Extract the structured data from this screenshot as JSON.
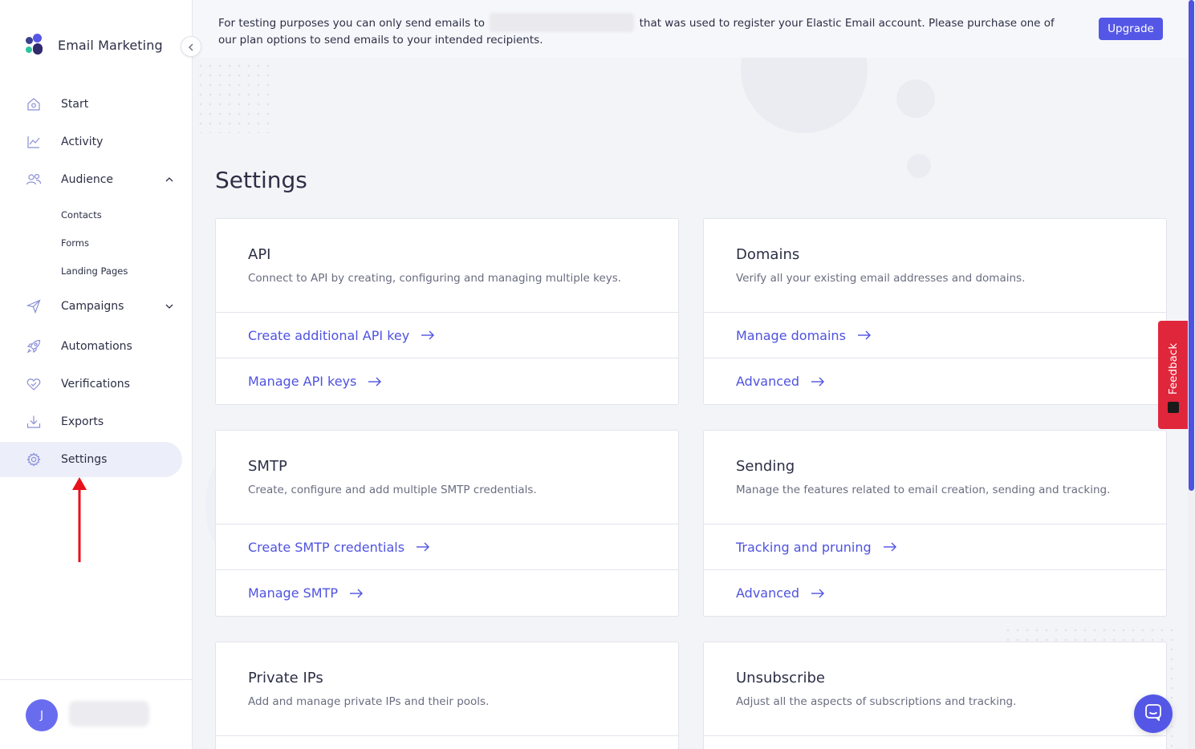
{
  "app": {
    "brand_name": "Email Marketing"
  },
  "sidebar": {
    "items": [
      {
        "key": "start",
        "label": "Start",
        "icon": "home-icon"
      },
      {
        "key": "activity",
        "label": "Activity",
        "icon": "chart-line-icon"
      },
      {
        "key": "audience",
        "label": "Audience",
        "icon": "users-icon",
        "expanded": true,
        "children": [
          {
            "label": "Contacts"
          },
          {
            "label": "Forms"
          },
          {
            "label": "Landing Pages"
          }
        ]
      },
      {
        "key": "campaigns",
        "label": "Campaigns",
        "icon": "paper-plane-icon",
        "expanded": false
      },
      {
        "key": "automations",
        "label": "Automations",
        "icon": "rocket-icon"
      },
      {
        "key": "verifications",
        "label": "Verifications",
        "icon": "heart-check-icon"
      },
      {
        "key": "exports",
        "label": "Exports",
        "icon": "download-icon"
      },
      {
        "key": "settings",
        "label": "Settings",
        "icon": "gear-icon",
        "active": true
      }
    ],
    "user": {
      "avatar_initial": "J"
    }
  },
  "banner": {
    "text_before": "For testing purposes you can only send emails to ",
    "text_after": " that was used to register your Elastic Email account. Please purchase one of our plan options to send emails to your intended recipients.",
    "upgrade_label": "Upgrade"
  },
  "main": {
    "title": "Settings",
    "cards": [
      {
        "title": "API",
        "description": "Connect to API by creating, configuring and managing multiple keys.",
        "links": [
          "Create additional API key",
          "Manage API keys"
        ]
      },
      {
        "title": "Domains",
        "description": "Verify all your existing email addresses and domains.",
        "links": [
          "Manage domains",
          "Advanced"
        ]
      },
      {
        "title": "SMTP",
        "description": "Create, configure and add multiple SMTP credentials.",
        "links": [
          "Create SMTP credentials",
          "Manage SMTP"
        ]
      },
      {
        "title": "Sending",
        "description": "Manage the features related to email creation, sending and tracking.",
        "links": [
          "Tracking and pruning",
          "Advanced"
        ]
      },
      {
        "title": "Private IPs",
        "description": "Add and manage private IPs and their pools.",
        "links": []
      },
      {
        "title": "Unsubscribe",
        "description": "Adjust all the aspects of subscriptions and tracking.",
        "links": []
      }
    ]
  },
  "feedback": {
    "label": "Feedback"
  },
  "colors": {
    "accent": "#5457e6",
    "link": "#4f52e0",
    "feedback": "#e0263b",
    "annotation": "#e8121b"
  }
}
